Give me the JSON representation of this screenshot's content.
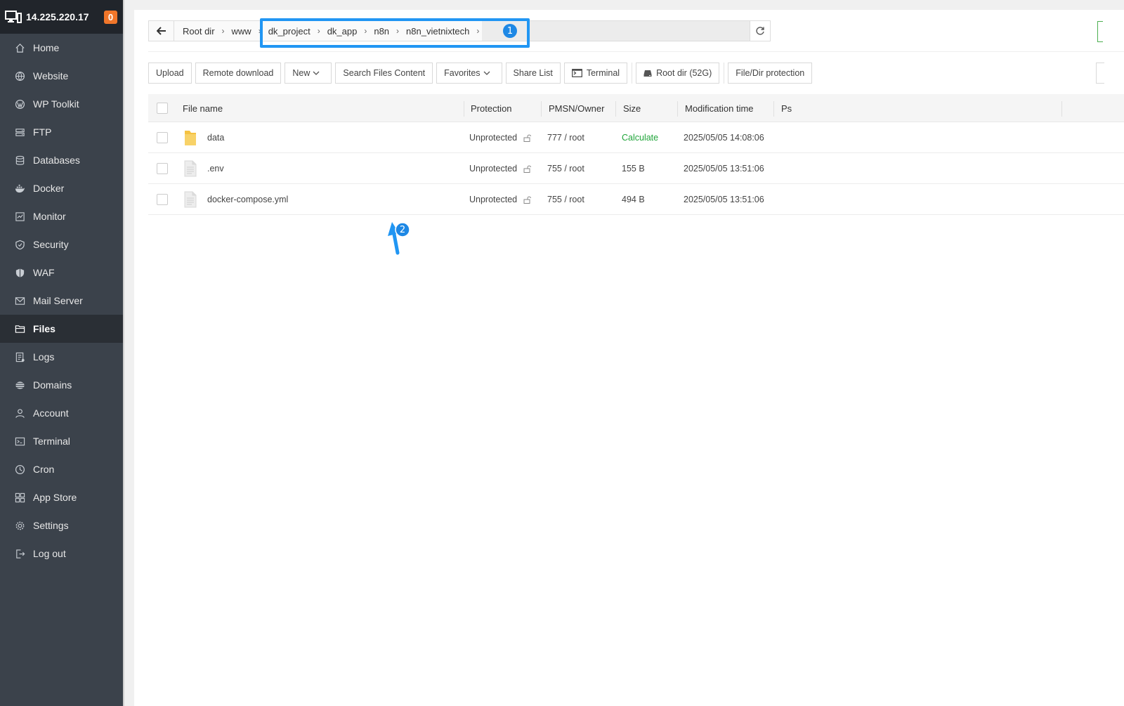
{
  "server": {
    "ip": "14.225.220.17",
    "badge": "0"
  },
  "sidebar": {
    "items": [
      {
        "label": "Home",
        "icon": "home-icon"
      },
      {
        "label": "Website",
        "icon": "globe-icon"
      },
      {
        "label": "WP Toolkit",
        "icon": "wordpress-icon"
      },
      {
        "label": "FTP",
        "icon": "ftp-icon"
      },
      {
        "label": "Databases",
        "icon": "database-icon"
      },
      {
        "label": "Docker",
        "icon": "docker-icon"
      },
      {
        "label": "Monitor",
        "icon": "monitor-icon"
      },
      {
        "label": "Security",
        "icon": "shield-icon"
      },
      {
        "label": "WAF",
        "icon": "waf-shield-icon"
      },
      {
        "label": "Mail Server",
        "icon": "mail-icon"
      },
      {
        "label": "Files",
        "icon": "folder-icon",
        "active": true
      },
      {
        "label": "Logs",
        "icon": "logs-icon"
      },
      {
        "label": "Domains",
        "icon": "domains-icon"
      },
      {
        "label": "Account",
        "icon": "user-icon"
      },
      {
        "label": "Terminal",
        "icon": "terminal-icon"
      },
      {
        "label": "Cron",
        "icon": "clock-icon"
      },
      {
        "label": "App Store",
        "icon": "grid-icon"
      },
      {
        "label": "Settings",
        "icon": "gear-icon"
      },
      {
        "label": "Log out",
        "icon": "logout-icon"
      }
    ]
  },
  "path": {
    "crumbs": [
      "Root dir",
      "www",
      "dk_project",
      "dk_app",
      "n8n",
      "n8n_vietnixtech"
    ]
  },
  "annotations": {
    "one": "1",
    "two": "2"
  },
  "toolbar": {
    "upload": "Upload",
    "remote_download": "Remote download",
    "new": "New",
    "search_files": "Search Files Content",
    "favorites": "Favorites",
    "share_list": "Share List",
    "terminal": "Terminal",
    "root_dir": "Root dir (52G)",
    "file_protection": "File/Dir protection"
  },
  "table": {
    "headers": {
      "name": "File name",
      "protection": "Protection",
      "pmsn": "PMSN/Owner",
      "size": "Size",
      "mtime": "Modification time",
      "ps": "Ps"
    },
    "rows": [
      {
        "type": "folder",
        "name": "data",
        "protection": "Unprotected",
        "pmsn": "777 / root",
        "size": "Calculate",
        "mtime": "2025/05/05 14:08:06"
      },
      {
        "type": "file",
        "name": ".env",
        "protection": "Unprotected",
        "pmsn": "755 / root",
        "size": "155 B",
        "mtime": "2025/05/05 13:51:06"
      },
      {
        "type": "file",
        "name": "docker-compose.yml",
        "protection": "Unprotected",
        "pmsn": "755 / root",
        "size": "494 B",
        "mtime": "2025/05/05 13:51:06"
      }
    ]
  },
  "colors": {
    "accent_blue": "#2196f3",
    "green": "#20a53a",
    "badge_orange": "#f0762a",
    "sidebar_bg": "#3b424b"
  }
}
